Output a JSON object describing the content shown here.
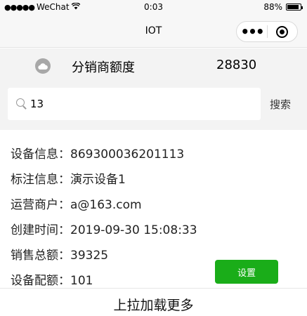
{
  "status_bar": {
    "carrier": "WeChat",
    "signal_dots": "●●●●●",
    "wifi_icon": "wifi-icon",
    "time": "0:03",
    "battery_percent": "88%",
    "battery_level": 0.88
  },
  "nav_bar": {
    "title": "IOT",
    "menu_icon": "more-dots-icon",
    "close_icon": "capsule-close-icon"
  },
  "quota": {
    "icon": "cloud-icon",
    "label": "分销商额度",
    "value": "28830"
  },
  "search": {
    "value": "13",
    "placeholder": "",
    "button_label": "搜索",
    "icon": "search-icon"
  },
  "device": {
    "rows": [
      {
        "key": "设备信息：",
        "value": "869300036201113"
      },
      {
        "key": "标注信息：",
        "value": "演示设备1"
      },
      {
        "key": "运营商户：",
        "value": "a@163.com"
      },
      {
        "key": "创建时间：",
        "value": "2019-09-30 15:08:33"
      },
      {
        "key": "销售总额：",
        "value": "39325"
      },
      {
        "key": "设备配额：",
        "value": "101"
      }
    ],
    "set_button_label": "设置",
    "set_button_color": "#1aad19"
  },
  "footer": {
    "load_more": "上拉加载更多"
  }
}
